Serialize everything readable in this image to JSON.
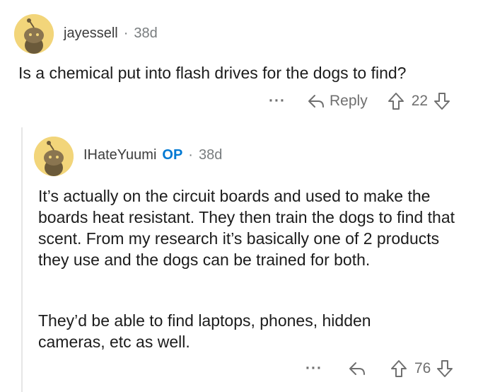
{
  "comment1": {
    "username": "jayessell",
    "separator": "·",
    "age": "38d",
    "text": "Is a chemical put into flash drives for the dogs to find?",
    "more_label": "···",
    "reply_label": "Reply",
    "score": "22"
  },
  "comment2": {
    "username": "IHateYuumi",
    "op_badge": "OP",
    "separator": "·",
    "age": "38d",
    "paragraph1": "It’s actually on the circuit boards and used to make the boards heat resistant.  They then train the dogs to find that scent.  From my research it’s basically one of 2 products they use and the dogs can be trained for both.",
    "paragraph2": "They’d be able to find laptops, phones, hidden cameras, etc as well.",
    "more_label": "···",
    "score": "76"
  },
  "colors": {
    "avatar_bg": "#f2d57a",
    "op_blue": "#0079d3",
    "muted": "#787c7e"
  },
  "icons": [
    "snoo-avatar-icon",
    "reply-arrow-icon",
    "upvote-icon",
    "downvote-icon",
    "more-options-icon"
  ]
}
